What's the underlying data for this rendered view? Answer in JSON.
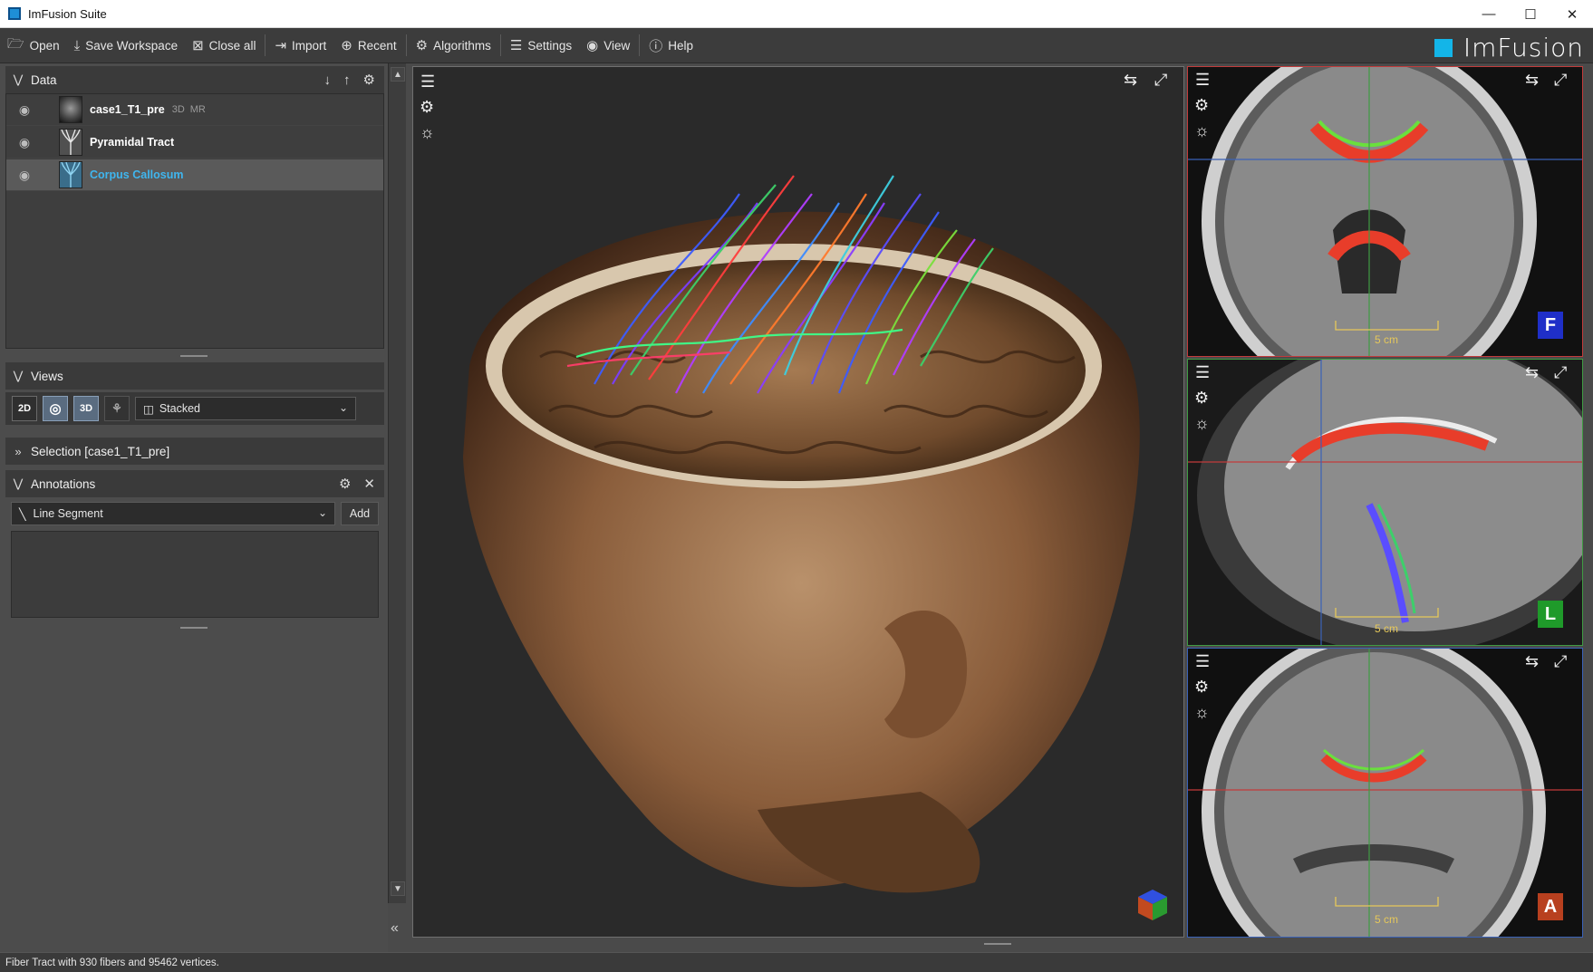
{
  "window": {
    "title": "ImFusion Suite",
    "controls": [
      "minimize",
      "maximize",
      "close"
    ]
  },
  "toolbar": {
    "items": [
      {
        "label": "Open",
        "icon": "folder-open-icon"
      },
      {
        "label": "Save Workspace",
        "icon": "download-icon"
      },
      {
        "label": "Close all",
        "icon": "close-box-icon"
      },
      {
        "label": "Import",
        "icon": "import-icon"
      },
      {
        "label": "Recent",
        "icon": "recent-icon"
      },
      {
        "label": "Algorithms",
        "icon": "gears-icon"
      },
      {
        "label": "Settings",
        "icon": "sliders-icon"
      },
      {
        "label": "View",
        "icon": "eye-icon"
      },
      {
        "label": "Help",
        "icon": "help-icon"
      }
    ],
    "brand": "ImFusion",
    "brand_color": "#13b5e8"
  },
  "data_panel": {
    "title": "Data",
    "items": [
      {
        "name": "case1_T1_pre",
        "tag1": "3D",
        "tag2": "MR"
      },
      {
        "name": "Pyramidal Tract"
      },
      {
        "name": "Corpus Callosum",
        "selected": true
      }
    ]
  },
  "views_panel": {
    "title": "Views",
    "buttons": [
      "2D",
      "",
      "3D",
      ""
    ],
    "layout": "Stacked"
  },
  "selection_panel": {
    "title": "Selection [case1_T1_pre]"
  },
  "annotations_panel": {
    "title": "Annotations",
    "type": "Line Segment",
    "add_label": "Add"
  },
  "viewports": {
    "scale_label": "5 cm",
    "badges": [
      {
        "letter": "F",
        "color": "#1f2fc8"
      },
      {
        "letter": "L",
        "color": "#1f9a2a"
      },
      {
        "letter": "A",
        "color": "#b8401f"
      }
    ]
  },
  "status": {
    "message": "Fiber Tract with 930 fibers and 95462 vertices."
  },
  "colors": {
    "accent": "#13b5e8",
    "frame_red": "#c23b3b",
    "frame_green": "#3f9b43",
    "frame_blue": "#3a62b8"
  }
}
